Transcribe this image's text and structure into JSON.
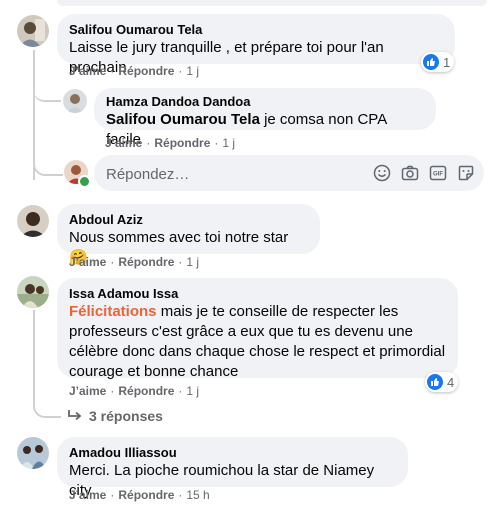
{
  "comments": [
    {
      "author": "Salifou Oumarou Tela",
      "text": "Laisse le jury tranquille , et prépare toi pour l'an prochain",
      "like": "J’aime",
      "reply": "Répondre",
      "time": "1 j",
      "reactions": "1",
      "replies": [
        {
          "author": "Hamza Dandoa Dandoa",
          "tag": "Salifou Oumarou Tela",
          "text": " je comsa non CPA facile",
          "like": "J’aime",
          "reply": "Répondre",
          "time": "1 j"
        }
      ],
      "reply_placeholder": "Répondez…"
    },
    {
      "author": "Abdoul Aziz",
      "text": "Nous sommes avec toi notre star",
      "emoji": "🤗",
      "like": "J’aime",
      "reply": "Répondre",
      "time": "1 j"
    },
    {
      "author": "Issa Adamou Issa",
      "highlight": "Félicitations",
      "text": " mais je te conseille de respecter les professeurs c'est grâce a eux que tu es devenu une célèbre donc dans chaque chose le respect et primordial courage et bonne chance",
      "like": "J’aime",
      "reply": "Répondre",
      "time": "1 j",
      "reactions": "4",
      "more_replies": "3 réponses"
    },
    {
      "author": "Amadou Illiassou",
      "text": "Merci. La pioche roumichou la star de Niamey city",
      "like": "J’aime",
      "reply": "Répondre",
      "time": "15 h"
    }
  ],
  "colors": {
    "bubble": "#f0f2f5",
    "meta": "#65676b",
    "like": "#1877f2",
    "highlight": "#e8643a"
  },
  "icons": [
    "like-icon",
    "emoji-icon",
    "camera-icon",
    "gif-icon",
    "sticker-icon",
    "reply-arrow-icon"
  ]
}
